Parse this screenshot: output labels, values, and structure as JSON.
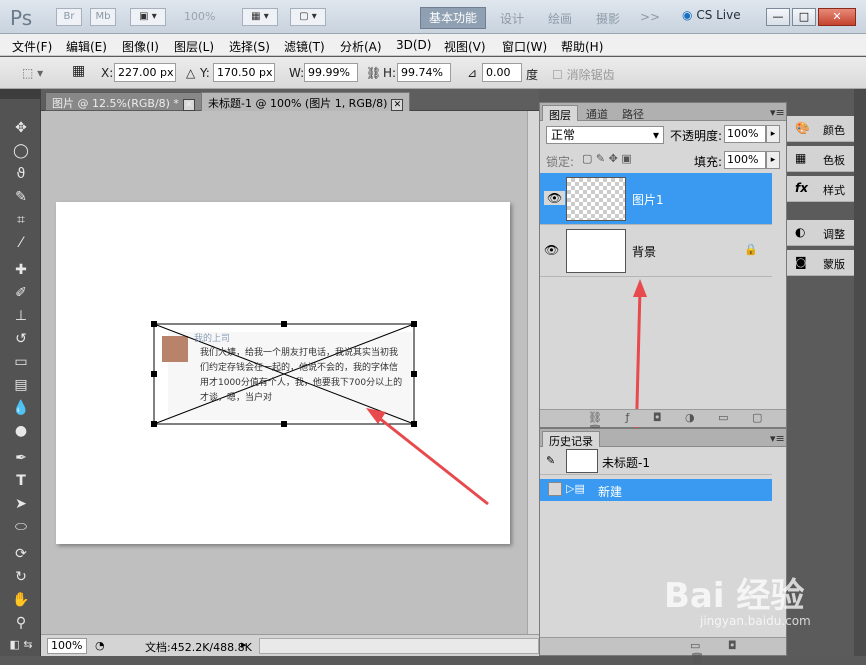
{
  "app": {
    "logo": "Ps",
    "bridge": "Br",
    "minibridge": "Mb",
    "zoom_readout": "100%",
    "workspaces": [
      "基本功能",
      "设计",
      "绘画",
      "摄影"
    ],
    "more": ">>",
    "cs_live": "CS Live",
    "window_controls": [
      "—",
      "□",
      "✕"
    ]
  },
  "menu": {
    "items": [
      "文件(F)",
      "编辑(E)",
      "图像(I)",
      "图层(L)",
      "选择(S)",
      "滤镜(T)",
      "分析(A)",
      "3D(D)",
      "视图(V)",
      "窗口(W)",
      "帮助(H)"
    ]
  },
  "options": {
    "x_label": "X:",
    "x_value": "227.00 px",
    "y_label": "Y:",
    "y_value": "170.50 px",
    "w_label": "W:",
    "w_value": "99.99%",
    "h_label": "H:",
    "h_value": "99.74%",
    "angle_value": "0.00",
    "angle_unit": "度",
    "antialias": "消除锯齿"
  },
  "tabs": [
    {
      "label": "图片 @ 12.5%(RGB/8) *",
      "close": "✕"
    },
    {
      "label": "未标题-1 @ 100% (图片 1, RGB/8)",
      "close": "✕"
    }
  ],
  "canvas_content": {
    "post_author": "我的上司",
    "post_text": "我们大姨，给我一个朋友打电话，我说其实当初我们约定存钱会在一起的，他说不会的，我的字体信用才1000分值有个人，我，他要我下700分以上的才谈，嗯，当户对"
  },
  "status": {
    "zoom": "100%",
    "doc_info": "文档:452.2K/488.8K"
  },
  "layers_panel": {
    "tabs": [
      "图层",
      "通道",
      "路径"
    ],
    "blend_mode": "正常",
    "opacity_label": "不透明度:",
    "opacity_value": "100%",
    "lock_label": "锁定:",
    "fill_label": "填充:",
    "fill_value": "100%",
    "layers": [
      {
        "name": "图片1",
        "selected": true
      },
      {
        "name": "背景",
        "selected": false
      }
    ]
  },
  "history_panel": {
    "title": "历史记录",
    "snapshot": "未标题-1",
    "items": [
      "新建"
    ]
  },
  "side_panels": [
    {
      "icon": "palette-icon",
      "label": "颜色"
    },
    {
      "icon": "swatches-icon",
      "label": "色板"
    },
    {
      "icon": "fx-icon",
      "label": "样式"
    },
    {
      "icon": "adjust-icon",
      "label": "调整"
    },
    {
      "icon": "mask-icon",
      "label": "蒙版"
    }
  ],
  "watermark": {
    "main": "Bai 经验",
    "sub": "jingyan.baidu.com"
  },
  "colors": {
    "selection_blue": "#3a9af2",
    "arrow_red": "#e8494d"
  }
}
